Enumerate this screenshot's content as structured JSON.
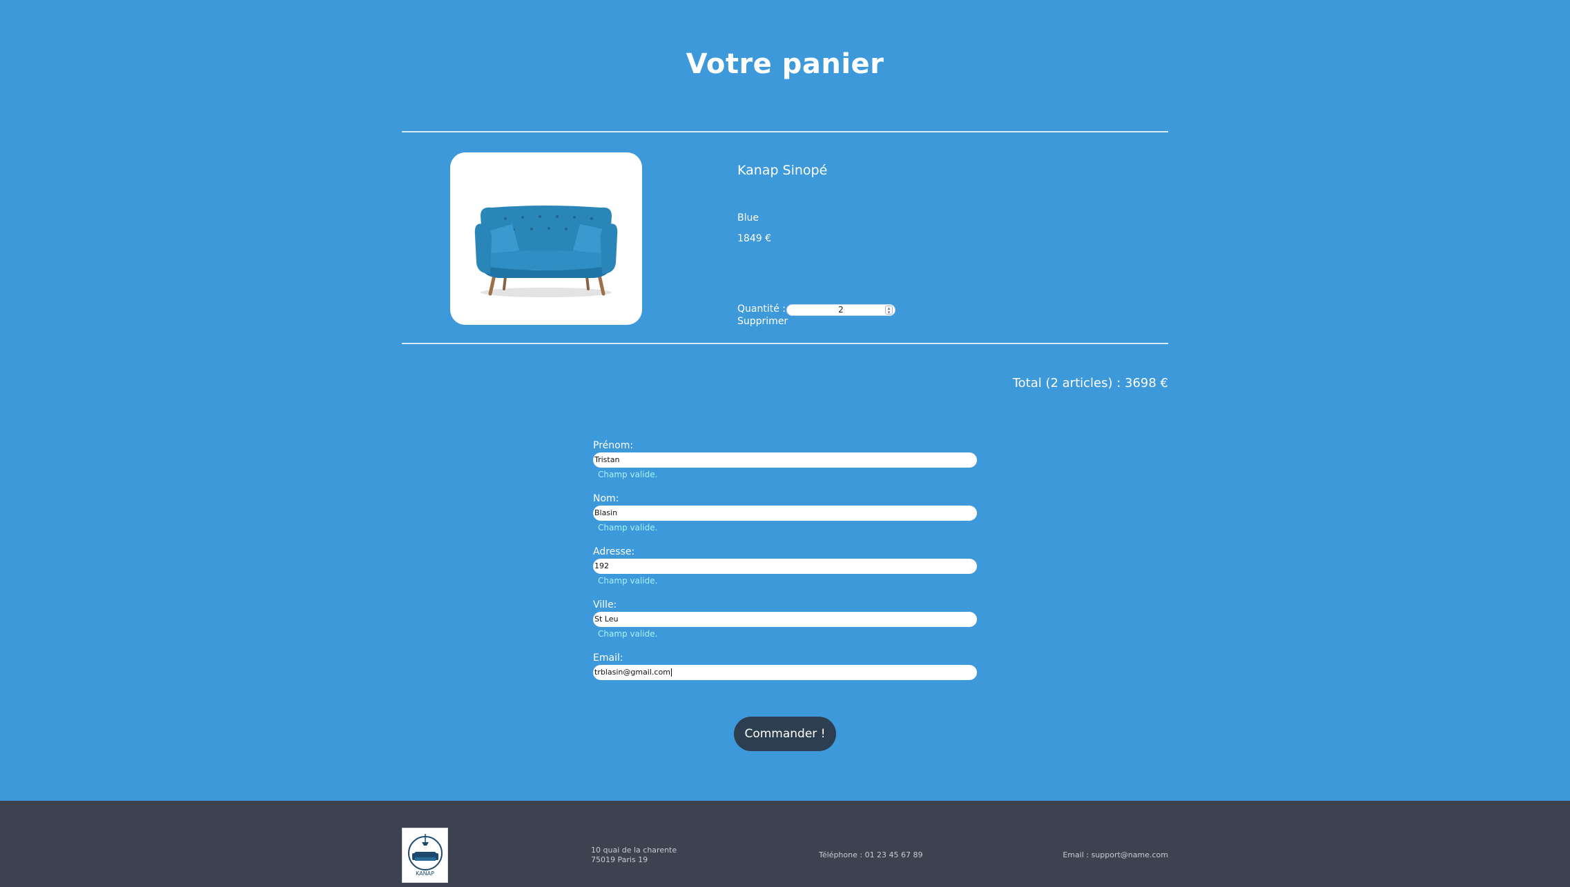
{
  "header": {
    "title": "Votre panier"
  },
  "cart": {
    "items": [
      {
        "name": "Kanap Sinopé",
        "color": "Blue",
        "price": "1849 €",
        "quantity_label": "Quantité :",
        "quantity": "2",
        "delete_label": "Supprimer"
      }
    ],
    "total_text": "Total (2 articles) : 3698 €"
  },
  "form": {
    "fields": [
      {
        "label": "Prénom:",
        "value": "Tristan",
        "message": "Champ valide."
      },
      {
        "label": "Nom:",
        "value": "Blasin",
        "message": "Champ valide."
      },
      {
        "label": "Adresse:",
        "value": "192",
        "message": "Champ valide."
      },
      {
        "label": "Ville:",
        "value": "St Leu",
        "message": "Champ valide."
      },
      {
        "label": "Email:",
        "value": "trblasin@gmail.com"
      }
    ],
    "submit_label": "Commander !"
  },
  "footer": {
    "logo_text": "KANAP",
    "address_line1": "10 quai de la charente",
    "address_line2": "75019 Paris 19",
    "phone": "Téléphone : 01 23 45 67 89",
    "email": "Email : support@name.com"
  },
  "colors": {
    "background": "#3d99da",
    "footer": "#3d4150",
    "button": "#2c3e50",
    "valid_message": "#a8f1ff"
  }
}
